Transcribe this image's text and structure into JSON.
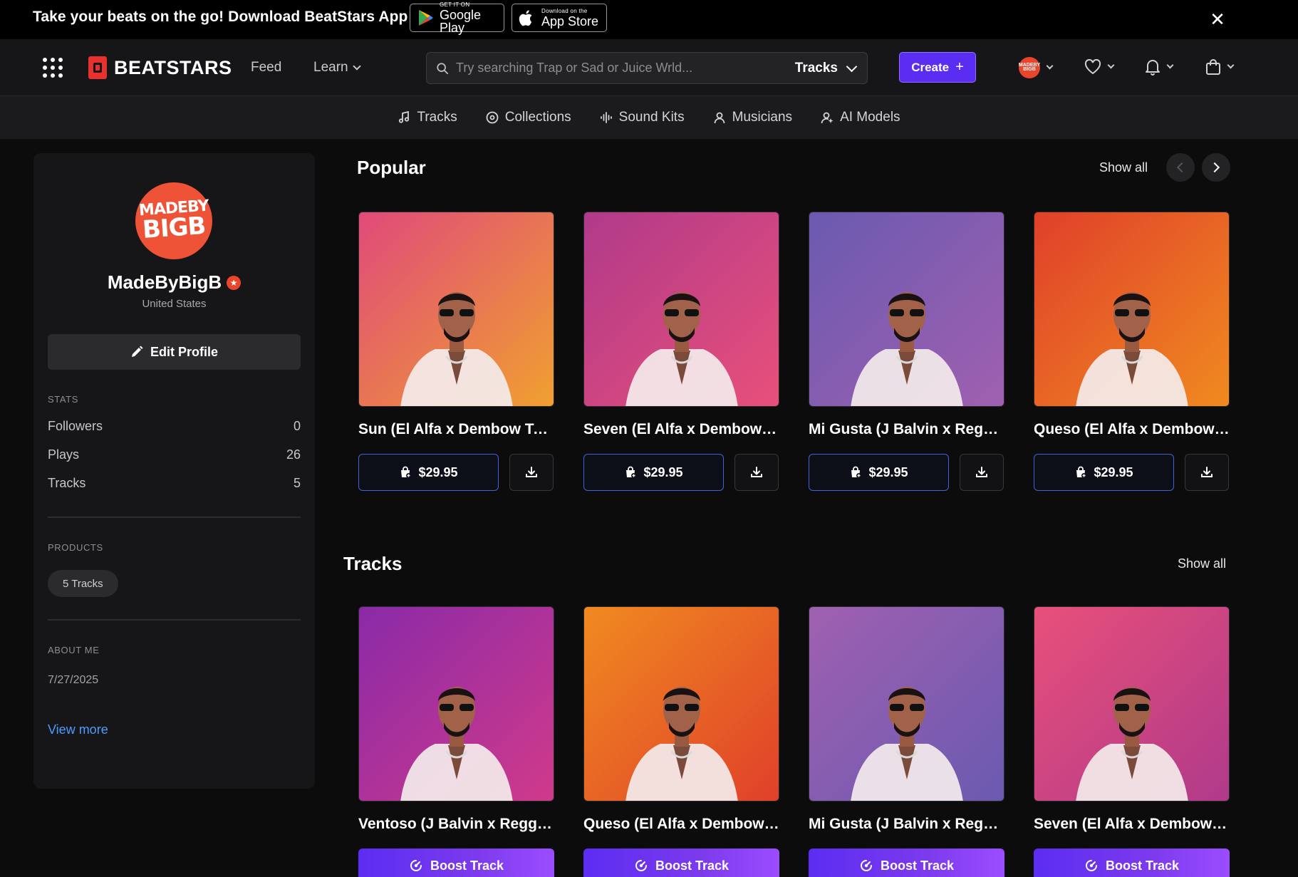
{
  "promo": {
    "text": "Take your beats on the go! Download BeatStars App",
    "google_play_small": "GET IT ON",
    "google_play_big": "Google Play",
    "app_store_small": "Download on the",
    "app_store_big": "App Store",
    "close_glyph": "✕"
  },
  "nav": {
    "brand": "BEATSTARS",
    "feed": "Feed",
    "learn": "Learn",
    "search_placeholder": "Try searching Trap or Sad or Juice Wrld...",
    "search_type": "Tracks",
    "create": "Create",
    "create_glyph": "+",
    "avatar_text": "MADEBY BIGB"
  },
  "categories": [
    {
      "label": "Tracks",
      "icon": "music-note-icon"
    },
    {
      "label": "Collections",
      "icon": "vinyl-icon"
    },
    {
      "label": "Sound Kits",
      "icon": "waveform-icon"
    },
    {
      "label": "Musicians",
      "icon": "person-icon"
    },
    {
      "label": "AI Models",
      "icon": "ai-person-icon"
    }
  ],
  "profile": {
    "avatar_line1": "MADEBY",
    "avatar_line2": "BIGB",
    "name": "MadeByBigB",
    "country": "United States",
    "edit_label": "Edit Profile",
    "stats_label": "STATS",
    "stats": [
      {
        "label": "Followers",
        "value": "0"
      },
      {
        "label": "Plays",
        "value": "26"
      },
      {
        "label": "Tracks",
        "value": "5"
      }
    ],
    "products_label": "PRODUCTS",
    "products_chip": "5 Tracks",
    "about_label": "ABOUT ME",
    "about_date": "7/27/2025",
    "view_more": "View more"
  },
  "popular": {
    "title": "Popular",
    "show_all": "Show all",
    "items": [
      {
        "title": "Sun (El Alfa x Dembow Type Beat)",
        "price": "$29.95",
        "bg": [
          "#f0a030",
          "#e04a7a"
        ]
      },
      {
        "title": "Seven (El Alfa x Dembow Type Beat)",
        "price": "$29.95",
        "bg": [
          "#e8507a",
          "#b03a8a"
        ]
      },
      {
        "title": "Mi Gusta (J Balvin x Reggaeton Type Beat)",
        "price": "$29.95",
        "bg": [
          "#a060b0",
          "#6a5ab0"
        ]
      },
      {
        "title": "Queso (El Alfa x Dembow Type Beat)",
        "price": "$29.95",
        "bg": [
          "#f08a20",
          "#e0402a"
        ]
      }
    ]
  },
  "tracks": {
    "title": "Tracks",
    "show_all": "Show all",
    "boost_label": "Boost Track",
    "items": [
      {
        "title": "Ventoso (J Balvin x Reggaeton Type Beat)",
        "bg": [
          "#8a2aa8",
          "#d03a8a"
        ]
      },
      {
        "title": "Queso (El Alfa x Dembow Type Beat)",
        "bg": [
          "#f08a20",
          "#e0402a"
        ]
      },
      {
        "title": "Mi Gusta (J Balvin x Reggaeton Type Beat)",
        "bg": [
          "#a060b0",
          "#6a5ab0"
        ]
      },
      {
        "title": "Seven (El Alfa x Dembow Type Beat)",
        "bg": [
          "#e8507a",
          "#b03a8a"
        ]
      }
    ]
  }
}
